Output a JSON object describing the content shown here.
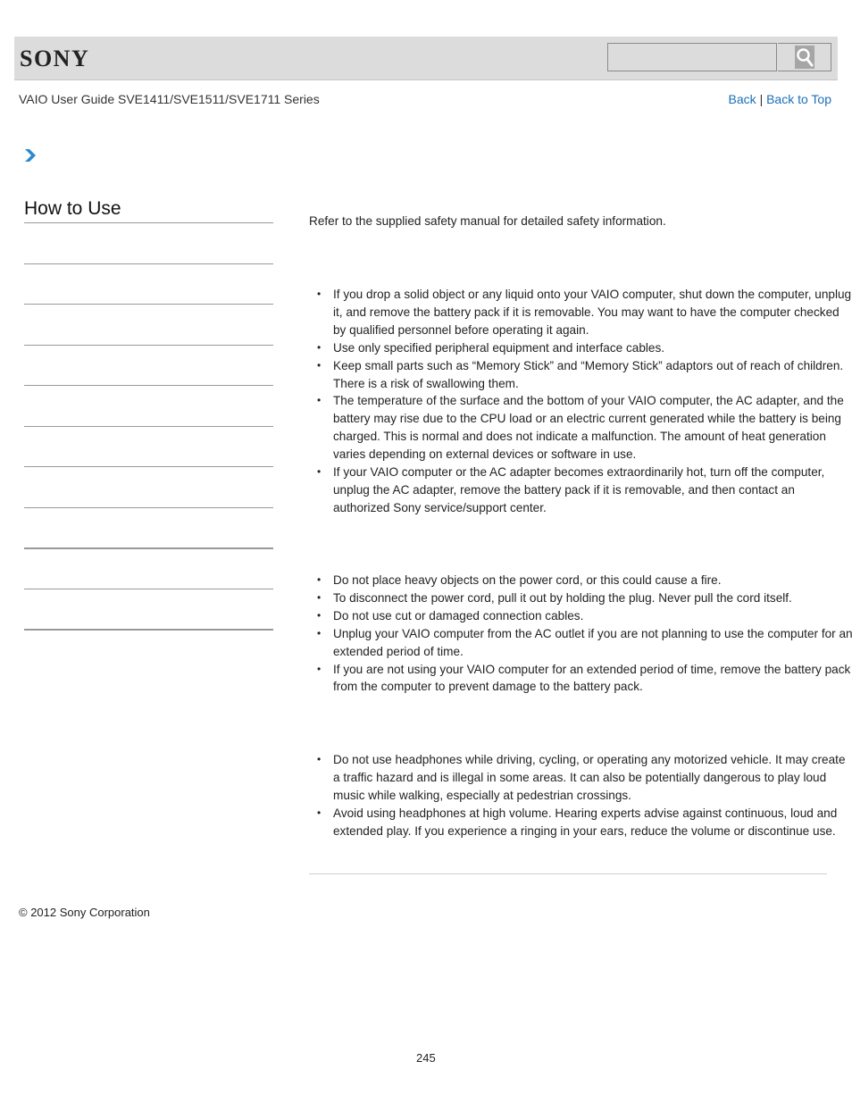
{
  "header": {
    "logo": "SONY",
    "search": {
      "placeholder": "",
      "value": ""
    },
    "search_icon": "search-icon"
  },
  "subheader": {
    "guide_title": "VAIO User Guide SVE1411/SVE1511/SVE1711 Series",
    "back_label": "Back",
    "separator": "|",
    "back_to_top_label": "Back to Top"
  },
  "breadcrumb": {
    "icon": "chevron-right-icon",
    "accent_color": "#1a6fb8"
  },
  "sidebar": {
    "title": "How to Use",
    "items": [
      "",
      "",
      "",
      "",
      "",
      "",
      "",
      "",
      "",
      ""
    ]
  },
  "main": {
    "intro": "Refer to the supplied safety manual for detailed safety information.",
    "sections": [
      {
        "items": [
          "If you drop a solid object or any liquid onto your VAIO computer, shut down the computer, unplug it, and remove the battery pack if it is removable. You may want to have the computer checked by qualified personnel before operating it again.",
          "Use only specified peripheral equipment and interface cables.",
          "Keep small parts such as “Memory Stick” and “Memory Stick” adaptors out of reach of children. There is a risk of swallowing them.",
          "The temperature of the surface and the bottom of your VAIO computer, the AC adapter, and the battery may rise due to the CPU load or an electric current generated while the battery is being charged. This is normal and does not indicate a malfunction. The amount of heat generation varies depending on external devices or software in use.",
          "If your VAIO computer or the AC adapter becomes extraordinarily hot, turn off the computer, unplug the AC adapter, remove the battery pack if it is removable, and then contact an authorized Sony service/support center."
        ]
      },
      {
        "items": [
          "Do not place heavy objects on the power cord, or this could cause a fire.",
          "To disconnect the power cord, pull it out by holding the plug. Never pull the cord itself.",
          "Do not use cut or damaged connection cables.",
          "Unplug your VAIO computer from the AC outlet if you are not planning to use the computer for an extended period of time.",
          "If you are not using your VAIO computer for an extended period of time, remove the battery pack from the computer to prevent damage to the battery pack."
        ]
      },
      {
        "items": [
          "Do not use headphones while driving, cycling, or operating any motorized vehicle. It may create a traffic hazard and is illegal in some areas. It can also be potentially dangerous to play loud music while walking, especially at pedestrian crossings.",
          "Avoid using headphones at high volume. Hearing experts advise against continuous, loud and extended play. If you experience a ringing in your ears, reduce the volume or discontinue use."
        ]
      }
    ]
  },
  "footer": {
    "copyright": "© 2012 Sony Corporation",
    "page_number": "245"
  }
}
